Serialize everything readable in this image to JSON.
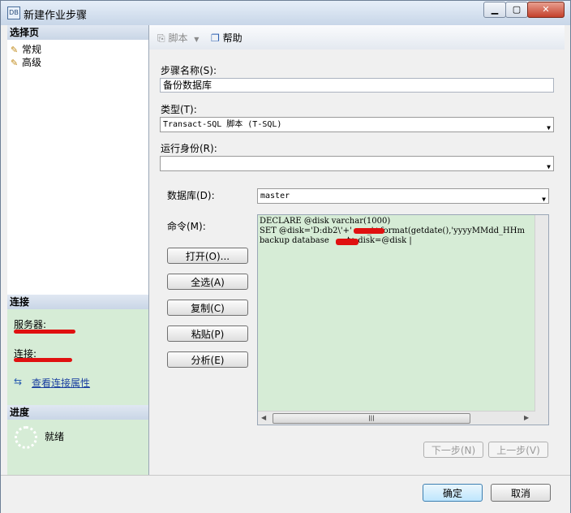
{
  "window": {
    "title": "新建作业步骤"
  },
  "left": {
    "select_page_header": "选择页",
    "pages": [
      "常规",
      "高级"
    ],
    "connection_header": "连接",
    "server_label": "服务器:",
    "connection_label": "连接:",
    "view_conn_link": "查看连接属性",
    "progress_header": "进度",
    "progress_status": "就绪"
  },
  "toolbar": {
    "script_label": "脚本",
    "help_label": "帮助"
  },
  "form": {
    "step_name_label": "步骤名称(S):",
    "step_name_value": "备份数据库",
    "type_label": "类型(T):",
    "type_value": "Transact-SQL 脚本 (T-SQL)",
    "run_as_label": "运行身份(R):",
    "run_as_value": "",
    "database_label": "数据库(D):",
    "database_value": "master",
    "command_label": "命令(M):",
    "command_lines": [
      "DECLARE @disk varchar(1000)",
      "SET @disk='D:db2\\'+'      _'+format(getdate(),'yyyyMMdd_HHm",
      "backup database       to disk=@disk |"
    ]
  },
  "buttons": {
    "open": "打开(O)...",
    "select_all": "全选(A)",
    "copy": "复制(C)",
    "paste": "粘贴(P)",
    "parse": "分析(E)",
    "next": "下一步(N)",
    "prev": "上一步(V)",
    "ok": "确定",
    "cancel": "取消"
  }
}
